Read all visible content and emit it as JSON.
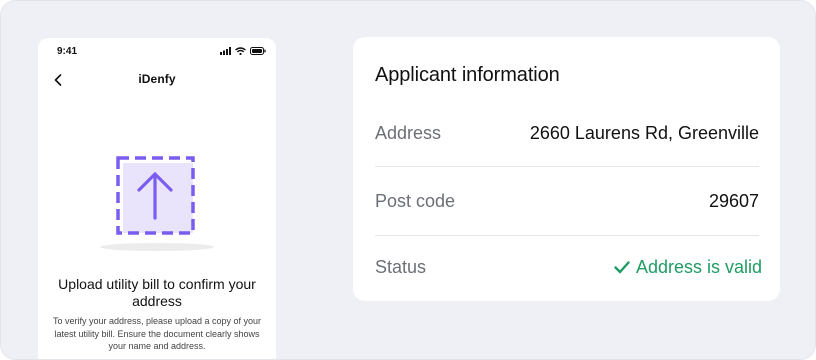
{
  "phone": {
    "status_time": "9:41",
    "brand": "iDenfy",
    "upload_title": "Upload utility bill to confirm your address",
    "upload_description": "To verify your address, please upload a copy of your latest utility bill. Ensure the document clearly shows your name and address.",
    "icons": [
      "signal-icon",
      "wifi-icon",
      "battery-icon",
      "back-arrow-icon",
      "upload-arrow-icon"
    ]
  },
  "card": {
    "title": "Applicant information",
    "rows": [
      {
        "label": "Address",
        "value": "2660 Laurens Rd, Greenville"
      },
      {
        "label": "Post code",
        "value": "29607"
      },
      {
        "label": "Status",
        "value": "Address is valid",
        "icon": "checkmark-icon"
      }
    ]
  },
  "colors": {
    "background": "#eff0f5",
    "accent": "#7b5cf0",
    "success": "#1e9d63"
  }
}
